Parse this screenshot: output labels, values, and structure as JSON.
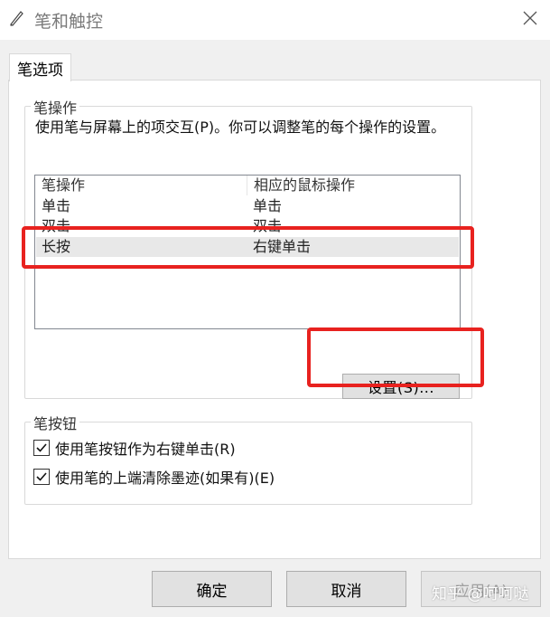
{
  "window": {
    "title": "笔和触控",
    "icon": "pen-icon",
    "close_icon": "close-icon"
  },
  "tabs": [
    {
      "label": "笔选项",
      "active": true
    }
  ],
  "pen_operations": {
    "group_title": "笔操作",
    "description": "使用笔与屏幕上的项交互(P)。你可以调整笔的每个操作的设置。",
    "list": {
      "columns": [
        "笔操作",
        "相应的鼠标操作"
      ],
      "rows": [
        {
          "action": "单击",
          "mouse": "单击",
          "selected": false
        },
        {
          "action": "双击",
          "mouse": "双击",
          "selected": false
        },
        {
          "action": "长按",
          "mouse": "右键单击",
          "selected": true
        }
      ]
    },
    "settings_button": "设置(S)..."
  },
  "pen_buttons": {
    "group_title": "笔按钮",
    "options": [
      {
        "label": "使用笔按钮作为右键单击(R)",
        "checked": true
      },
      {
        "label": "使用笔的上端清除墨迹(如果有)(E)",
        "checked": true
      }
    ]
  },
  "footer": {
    "ok": "确定",
    "cancel": "取消",
    "apply": "应用(A)"
  },
  "watermark": "知乎 @呵呵哒",
  "colors": {
    "annotation": "#e8221f",
    "selected_row": "#e8e8e8",
    "button_bg": "#e1e1e1"
  }
}
